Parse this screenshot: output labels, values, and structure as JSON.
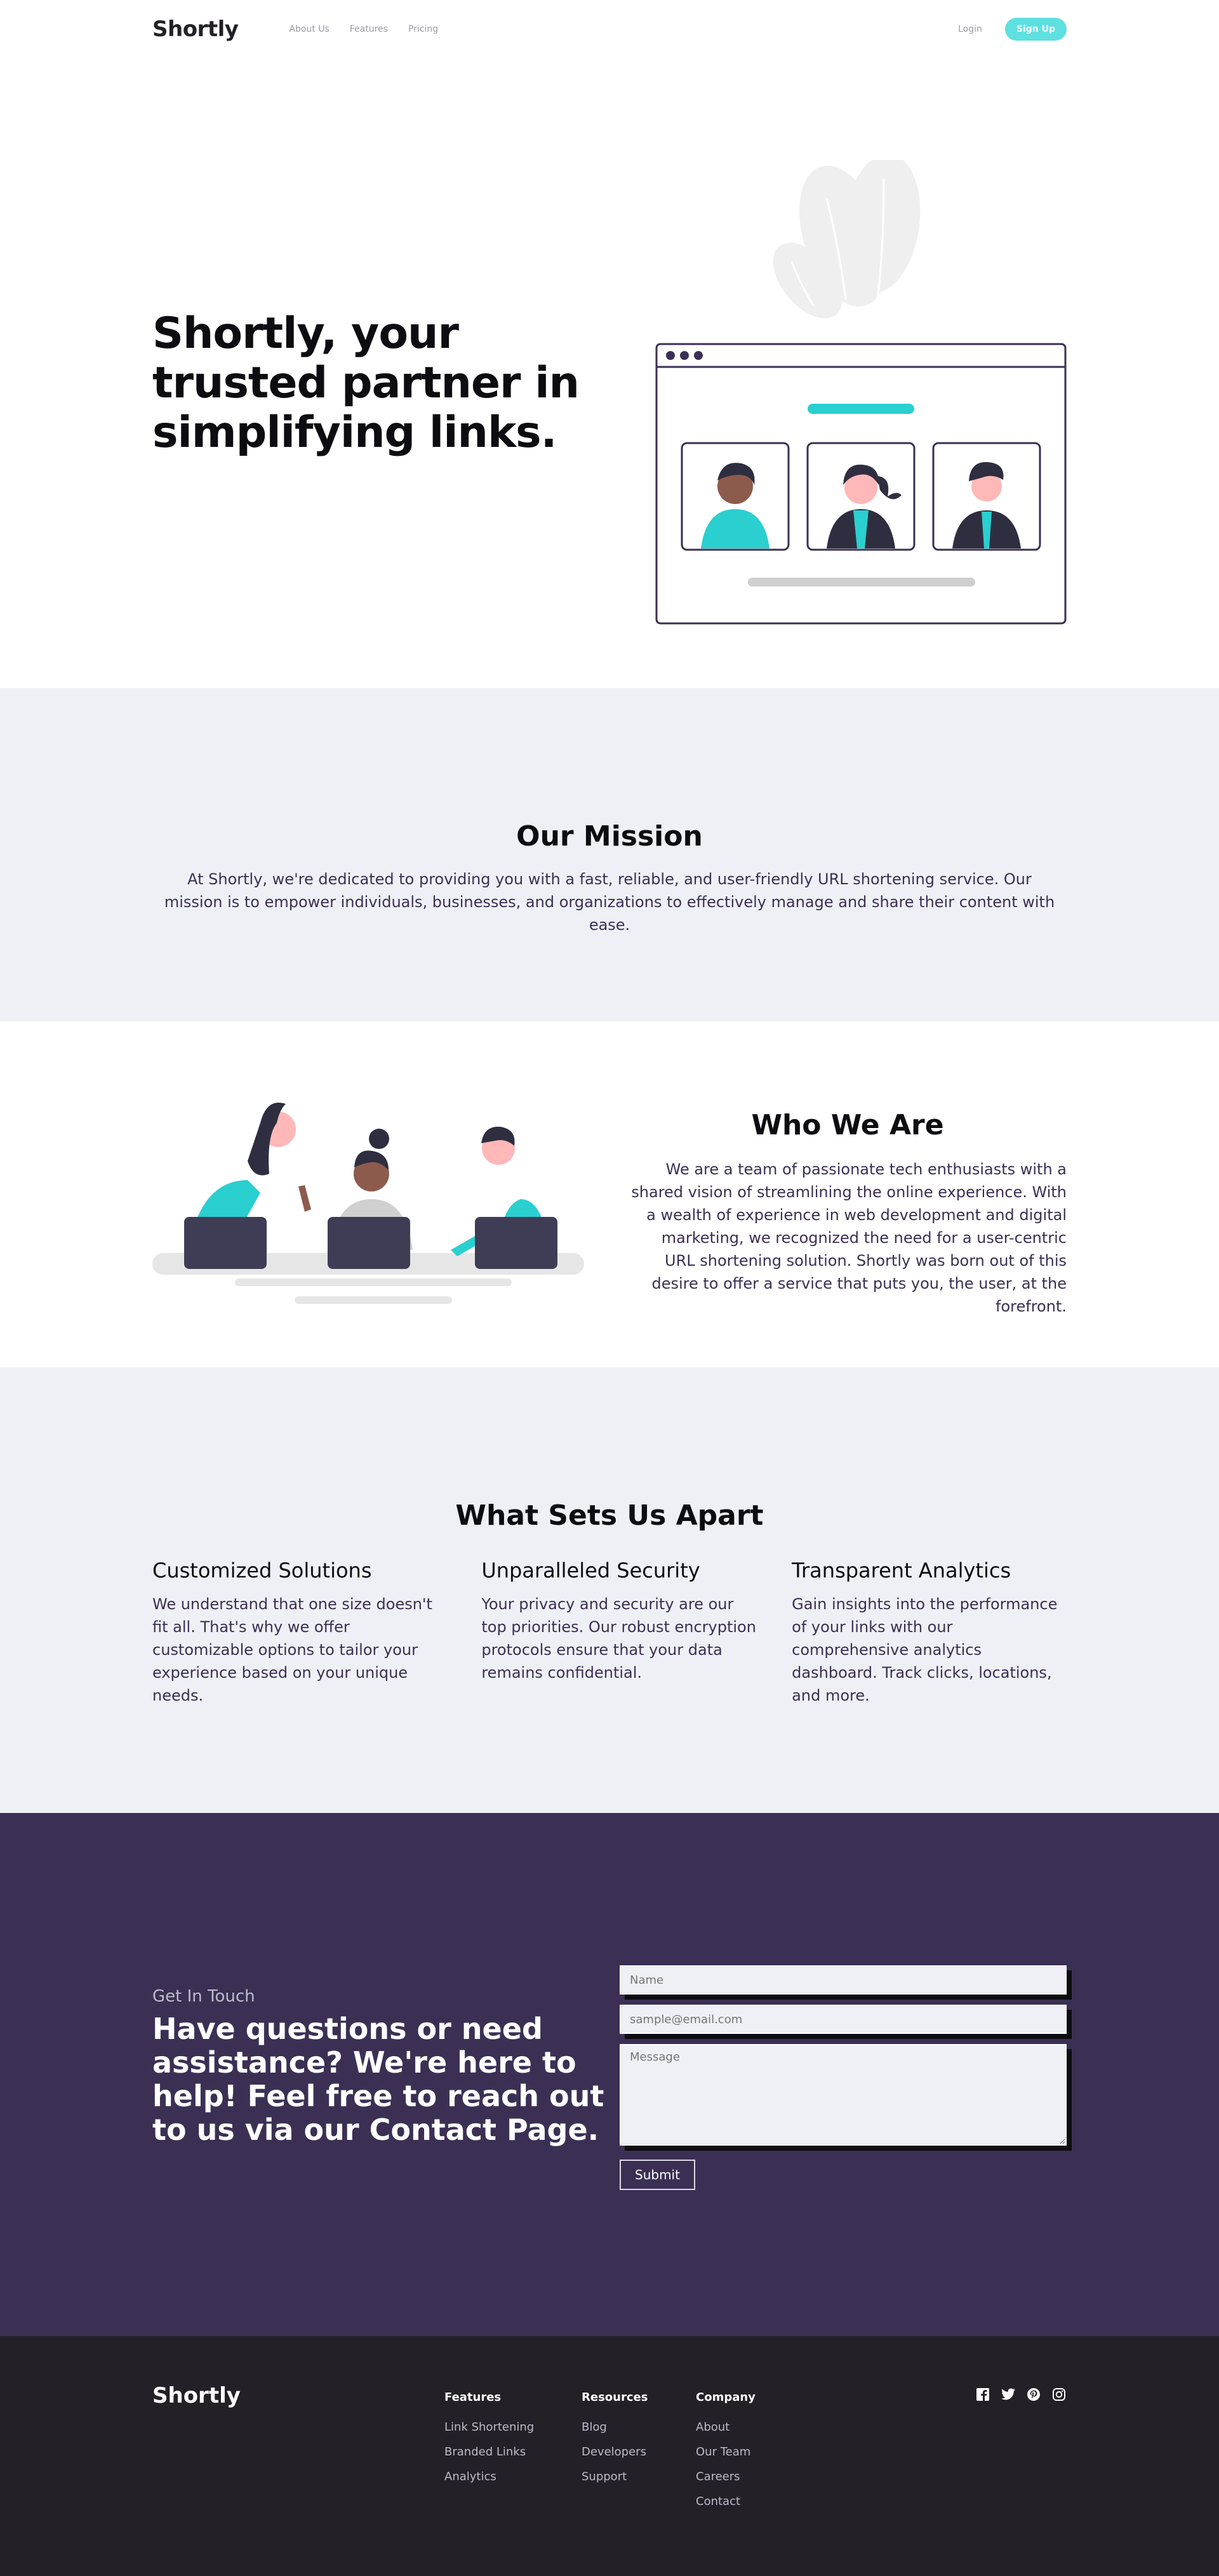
{
  "header": {
    "logo": "Shortly",
    "nav": [
      "About Us",
      "Features",
      "Pricing"
    ],
    "login": "Login",
    "signup": "Sign Up"
  },
  "hero": {
    "title": "Shortly, your trusted partner in simplifying links."
  },
  "mission": {
    "title": "Our Mission",
    "text": "At Shortly, we're dedicated to providing you with a fast, reliable, and user-friendly URL shortening service. Our mission is to empower individuals, businesses, and organizations to effectively manage and share their content with ease."
  },
  "who": {
    "title": "Who We Are",
    "text": "We are a team of passionate tech enthusiasts with a shared vision of streamlining the online experience. With a wealth of experience in web development and digital marketing, we recognized the need for a user-centric URL shortening solution. Shortly was born out of this desire to offer a service that puts you, the user, at the forefront."
  },
  "apart": {
    "title": "What Sets Us Apart",
    "features": [
      {
        "title": "Customized Solutions",
        "text": "We understand that one size doesn't fit all. That's why we offer customizable options to tailor your experience based on your unique needs."
      },
      {
        "title": "Unparalleled Security",
        "text": "Your privacy and security are our top priorities. Our robust encryption protocols ensure that your data remains confidential."
      },
      {
        "title": "Transparent Analytics",
        "text": "Gain insights into the performance of your links with our comprehensive analytics dashboard. Track clicks, locations, and more."
      }
    ]
  },
  "contact": {
    "kicker": "Get In Touch",
    "title": "Have questions or need assistance? We're here to help! Feel free to reach out to us via our Contact Page.",
    "name_placeholder": "Name",
    "email_placeholder": "sample@email.com",
    "message_placeholder": "Message",
    "submit": "Submit"
  },
  "footer": {
    "logo": "Shortly",
    "columns": [
      {
        "title": "Features",
        "items": [
          "Link Shortening",
          "Branded Links",
          "Analytics"
        ]
      },
      {
        "title": "Resources",
        "items": [
          "Blog",
          "Developers",
          "Support"
        ]
      },
      {
        "title": "Company",
        "items": [
          "About",
          "Our Team",
          "Careers",
          "Contact"
        ]
      }
    ],
    "socials": [
      "facebook-icon",
      "twitter-icon",
      "pinterest-icon",
      "instagram-icon"
    ]
  },
  "colors": {
    "accent": "#2acfcf",
    "dark_violet": "#3b3054",
    "footer_bg": "#232127",
    "light_bg": "#eff0f5"
  }
}
